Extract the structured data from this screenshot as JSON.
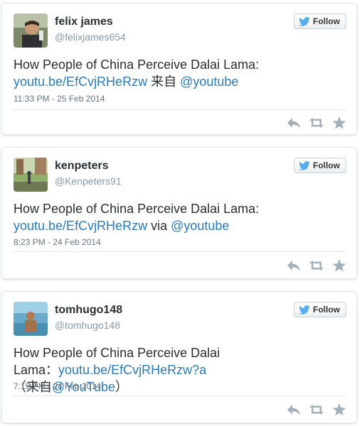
{
  "colors": {
    "link": "#2b7bb9",
    "name": "#292f33",
    "muted": "#8899a6",
    "twitter_blue": "#55acee",
    "action_gray": "#a4b0b9"
  },
  "tweets": [
    {
      "name": "felix james",
      "handle": "@felixjames654",
      "follow_label": "Follow",
      "text_pre": "How People of China Perceive Dalai Lama:",
      "link": "youtu.be/EfCvjRHeRzw",
      "text_mid": " 来自 ",
      "mention": "@youtube",
      "text_post": "",
      "timestamp": "11:33 PM - 25 Feb 2014"
    },
    {
      "name": "kenpeters",
      "handle": "@Kenpeters91",
      "follow_label": "Follow",
      "text_pre": "How People of China Perceive Dalai Lama:",
      "link": "youtu.be/EfCvjRHeRzw",
      "text_mid": " via ",
      "mention": "@youtube",
      "text_post": "",
      "timestamp": "8:23 PM - 24 Feb 2014"
    },
    {
      "name": "tomhugo148",
      "handle": "@tomhugo148",
      "follow_label": "Follow",
      "text_pre": "How People of China Perceive Dalai Lama：",
      "link": "youtu.be/EfCvjRHeRzw?a",
      "text_mid": "（来自",
      "mention": "@YouTube",
      "text_post": "）",
      "timestamp": "7:15 PM - 24 Feb 2014"
    }
  ],
  "icons": {
    "follow": "twitter-bird-icon",
    "reply": "reply-icon",
    "retweet": "retweet-icon",
    "favorite": "star-icon"
  }
}
